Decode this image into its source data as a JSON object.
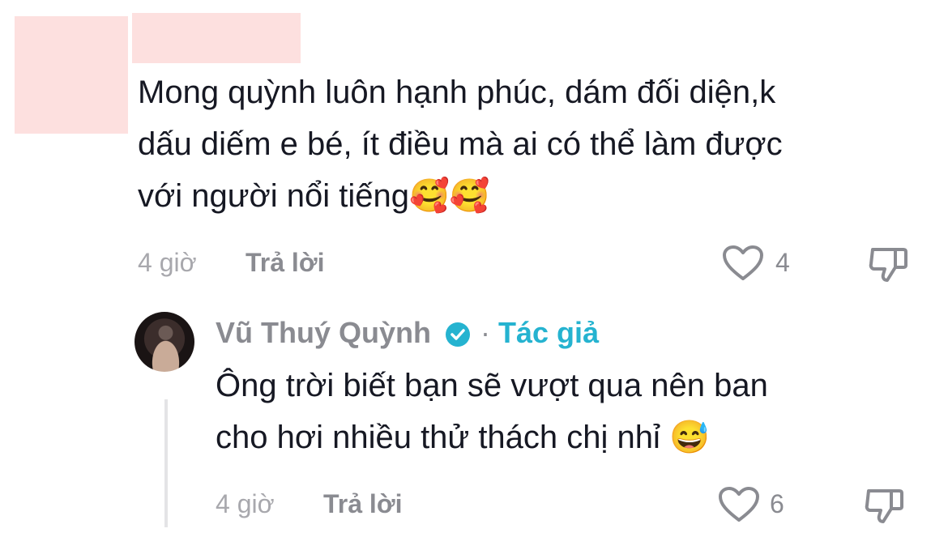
{
  "comment": {
    "text_lines": [
      "Mong quỳnh luôn hạnh phúc, dám đối diện,k",
      "dấu diếm e bé, ít điều mà ai có thể làm được",
      "với người nổi tiếng🥰🥰"
    ],
    "time": "4 giờ",
    "reply_label": "Trả lời",
    "like_count": "4"
  },
  "reply": {
    "author_name": "Vũ Thuý Quỳnh",
    "author_tag": "Tác giả",
    "separator": "·",
    "text_lines": [
      "Ông trời biết bạn sẽ vượt qua nên ban",
      "cho hơi nhiều thử thách chị nhỉ 😅"
    ],
    "time": "4 giờ",
    "reply_label": "Trả lời",
    "like_count": "6"
  },
  "icons": {
    "like": "heart-outline-icon",
    "dislike": "thumbs-down-icon",
    "verified": "verified-badge-icon"
  },
  "colors": {
    "text": "#161823",
    "muted": "#8a8b91",
    "accent": "#25b3d0",
    "redaction": "#fde0df"
  }
}
